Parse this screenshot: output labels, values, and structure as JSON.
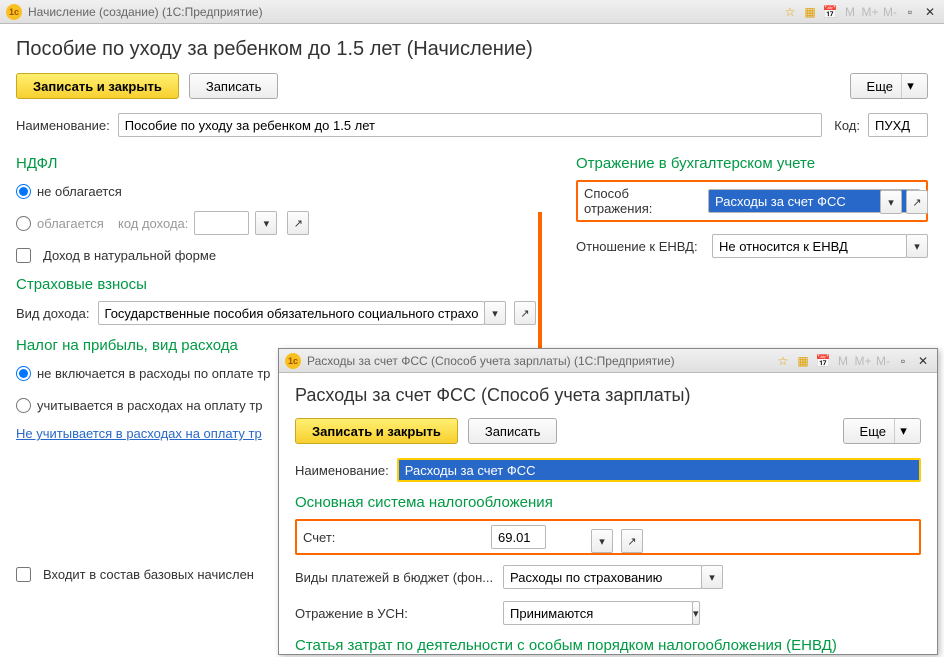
{
  "main": {
    "title_bar": "Начисление (создание) (1С:Предприятие)",
    "heading": "Пособие по уходу за ребенком до 1.5 лет (Начисление)",
    "save_close": "Записать и закрыть",
    "save": "Записать",
    "more": "Еще",
    "name_label": "Наименование:",
    "name_value": "Пособие по уходу за ребенком до 1.5 лет",
    "code_label": "Код:",
    "code_value": "ПУХД",
    "ndfl": {
      "title": "НДФЛ",
      "not_taxed": "не облагается",
      "taxed": "облагается",
      "income_code_label": "код дохода:",
      "natural": "Доход в натуральной форме"
    },
    "bu": {
      "title": "Отражение в бухгалтерском учете",
      "method_label": "Способ отражения:",
      "method_value": "Расходы за счет ФСС",
      "envd_label": "Отношение к ЕНВД:",
      "envd_value": "Не относится к ЕНВД"
    },
    "insurance": {
      "title": "Страховые взносы",
      "income_type_label": "Вид дохода:",
      "income_type_value": "Государственные пособия обязательного социального страхован"
    },
    "profit": {
      "title": "Налог на прибыль, вид расхода",
      "opt1": "не включается в расходы по оплате тр",
      "opt2": "учитывается в расходах на оплату тр",
      "link": "Не учитывается в расходах на оплату тр"
    },
    "base": {
      "cb": "Входит в состав базовых начислен"
    }
  },
  "sub": {
    "title_bar": "Расходы за счет ФСС (Способ учета зарплаты) (1С:Предприятие)",
    "heading": "Расходы за счет ФСС (Способ учета зарплаты)",
    "save_close": "Записать и закрыть",
    "save": "Записать",
    "more": "Еще",
    "name_label": "Наименование:",
    "name_value": "Расходы за счет ФСС",
    "section1": "Основная система налогообложения",
    "account_label": "Счет:",
    "account_value": "69.01",
    "payment_types_label": "Виды платежей в бюджет (фон...",
    "payment_types_value": "Расходы по страхованию",
    "usn_label": "Отражение в УСН:",
    "usn_value": "Принимаются",
    "section2": "Статья затрат по деятельности с особым порядком налогообложения (ЕНВД)"
  }
}
